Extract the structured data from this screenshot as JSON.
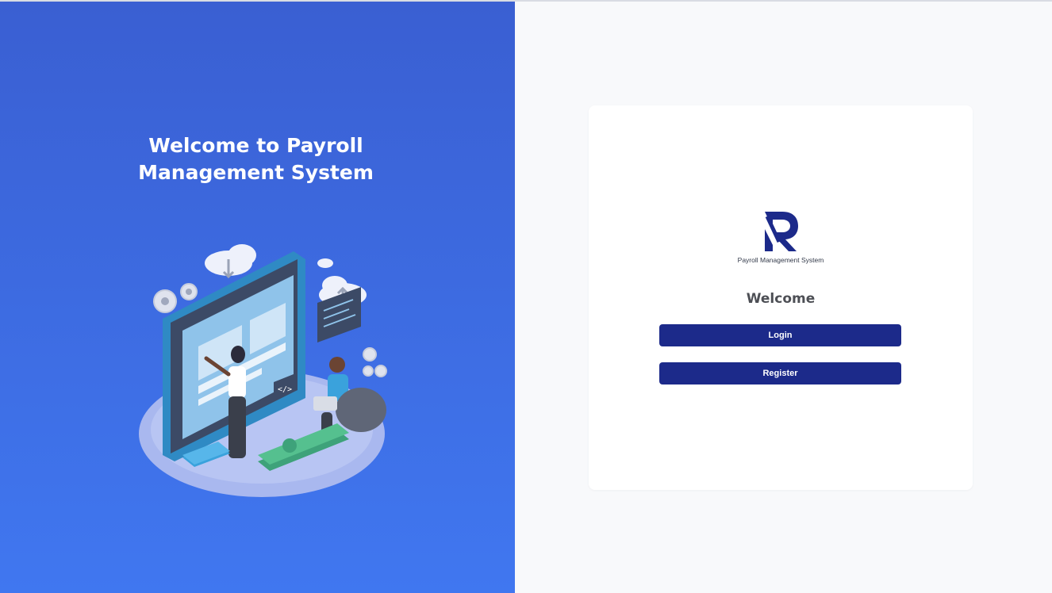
{
  "hero": {
    "title": "Welcome to Payroll Management System",
    "illustration_icon": "payroll-team-illustration"
  },
  "brand": {
    "logo_icon": "r-logo-icon",
    "caption": "Payroll Management System",
    "color": "#1c2a8a"
  },
  "card": {
    "heading": "Welcome",
    "login_label": "Login",
    "register_label": "Register"
  },
  "colors": {
    "hero_gradient_top": "#3a5fd2",
    "hero_gradient_bottom": "#4077f0",
    "button": "#1c2a8a",
    "background": "#f8f9fb"
  }
}
